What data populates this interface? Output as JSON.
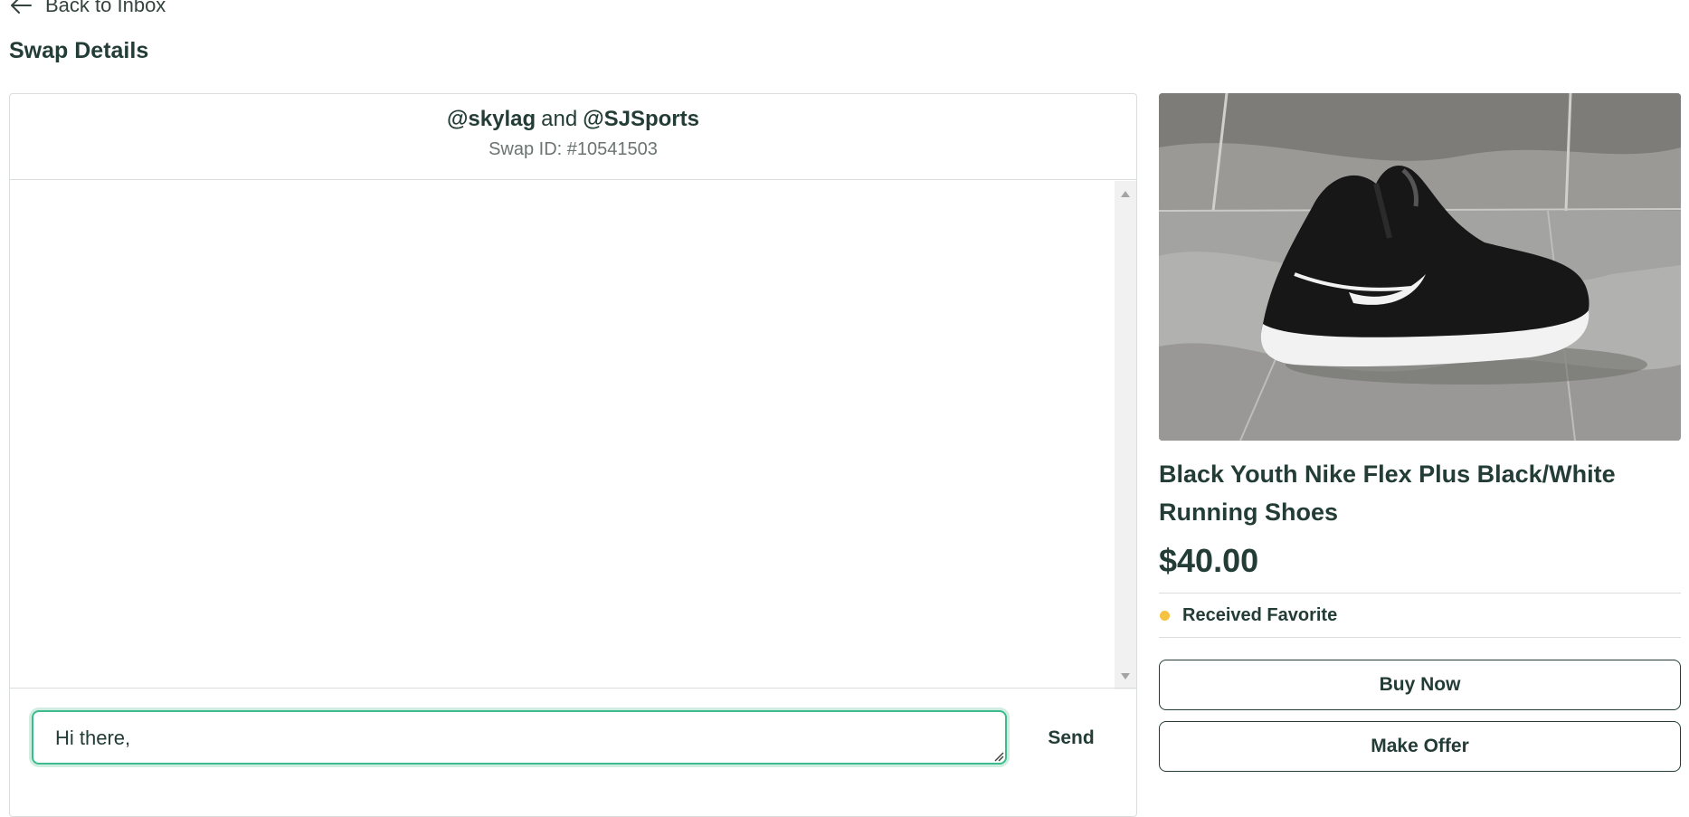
{
  "nav": {
    "back_label": "Back to Inbox"
  },
  "page": {
    "title": "Swap Details"
  },
  "chat": {
    "user_one": "@skylag",
    "connector": "and",
    "user_two": "@SJSports",
    "swap_id": "Swap ID: #10541503",
    "input_value": "Hi there,",
    "send_label": "Send"
  },
  "item": {
    "image_icon": "sneaker-photo",
    "title": "Black Youth Nike Flex Plus Black/White Running Shoes",
    "price": "$40.00",
    "status": "Received Favorite",
    "status_color": "#f5c242",
    "buy_label": "Buy Now",
    "offer_label": "Make Offer"
  },
  "colors": {
    "text_primary": "#233d36",
    "input_focus": "#3dbb8c",
    "border": "#d9dedc"
  }
}
